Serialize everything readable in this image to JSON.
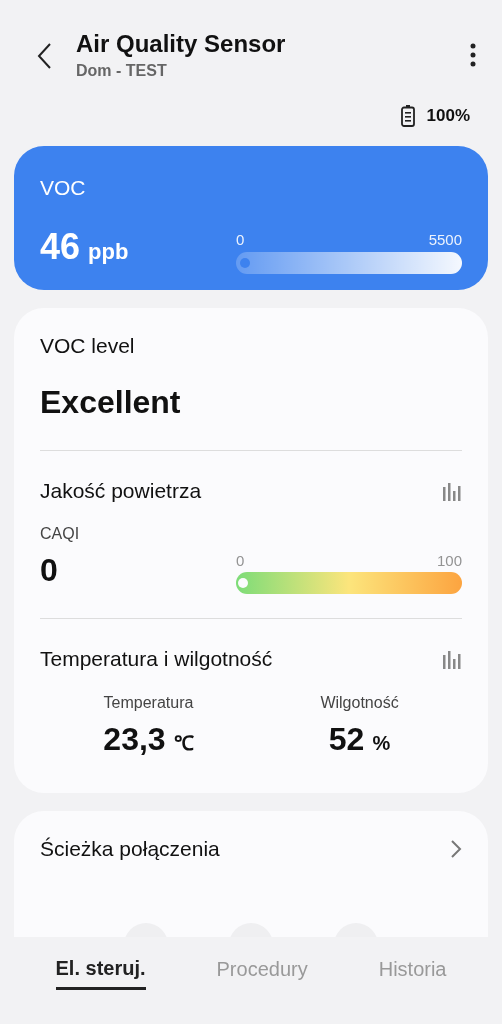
{
  "header": {
    "title": "Air Quality Sensor",
    "subtitle": "Dom - TEST",
    "battery": "100%"
  },
  "voc": {
    "label": "VOC",
    "value": "46",
    "unit": "ppb",
    "min": "0",
    "max": "5500",
    "level": 0.008
  },
  "details": {
    "level_label": "VOC level",
    "level_value": "Excellent",
    "air": {
      "title": "Jakość powietrza",
      "index_label": "CAQI",
      "index_value": "0",
      "min": "0",
      "max": "100",
      "level": 0
    },
    "climate": {
      "title": "Temperatura i wilgotność",
      "items": [
        {
          "label": "Temperatura",
          "value": "23,3",
          "unit": "℃"
        },
        {
          "label": "Wilgotność",
          "value": "52",
          "unit": "%"
        }
      ]
    }
  },
  "connection": {
    "title": "Ścieżka połączenia"
  },
  "tabs": [
    {
      "label": "El. steruj.",
      "selected": true
    },
    {
      "label": "Procedury",
      "selected": false
    },
    {
      "label": "Historia",
      "selected": false
    }
  ]
}
